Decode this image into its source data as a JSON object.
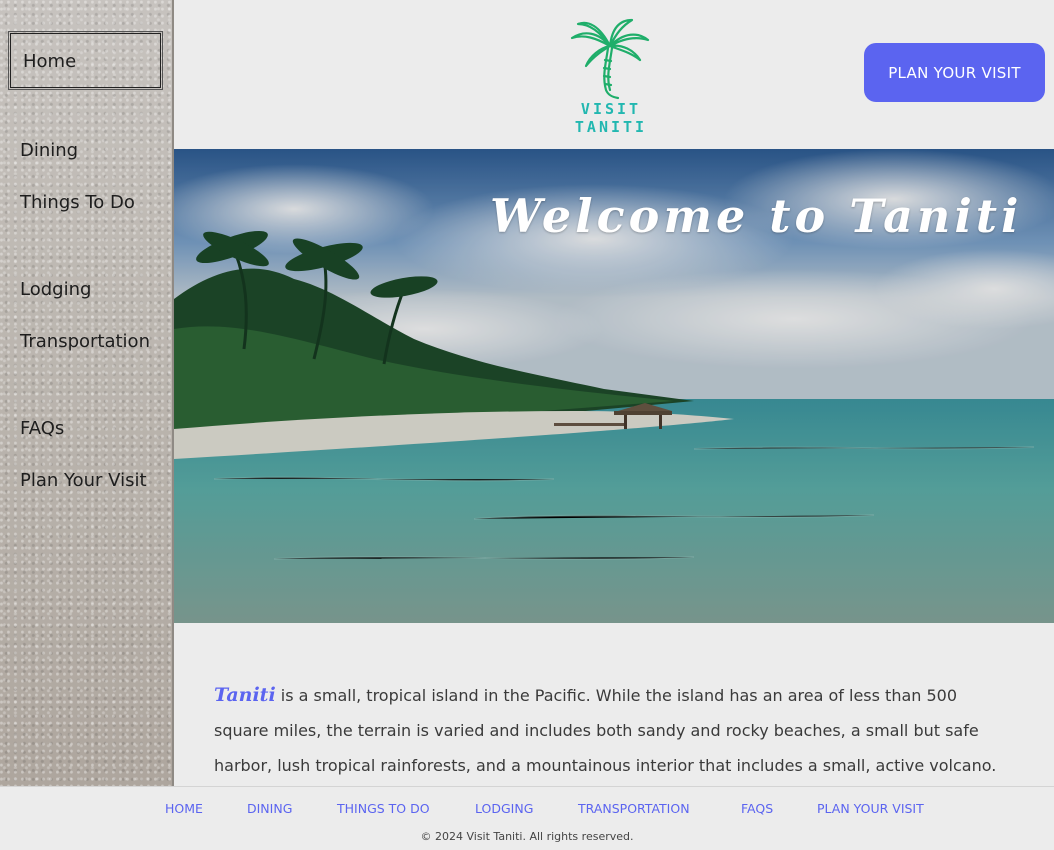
{
  "sidebar": {
    "items": [
      {
        "label": "Home"
      },
      {
        "label": "Dining"
      },
      {
        "label": "Things To Do"
      },
      {
        "label": "Lodging"
      },
      {
        "label": "Transportation"
      },
      {
        "label": "FAQs"
      },
      {
        "label": "Plan Your Visit"
      }
    ],
    "active": "Home"
  },
  "header": {
    "logo_text": "VISIT TANITI",
    "logo_icon": "palm-tree-icon",
    "cta_label": "PLAN YOUR VISIT"
  },
  "hero": {
    "title": "Welcome to Taniti"
  },
  "content": {
    "brand": "Taniti",
    "intro": " is a small, tropical island in the Pacific. While the island has an area of less than 500 square miles, the terrain is varied and includes both sandy and rocky beaches, a small but safe harbor, lush tropical rainforests, and a mountainous interior that includes a small, active volcano. Taniti has an"
  },
  "footer": {
    "links": [
      {
        "label": "HOME"
      },
      {
        "label": "DINING"
      },
      {
        "label": "THINGS TO DO"
      },
      {
        "label": "LODGING"
      },
      {
        "label": "TRANSPORTATION"
      },
      {
        "label": "FAQS"
      },
      {
        "label": "PLAN YOUR VISIT"
      }
    ],
    "copyright": "© 2024 Visit Taniti. All rights reserved."
  },
  "colors": {
    "accent": "#5b64f0",
    "logo": "#22b7b0",
    "background": "#ececec"
  }
}
